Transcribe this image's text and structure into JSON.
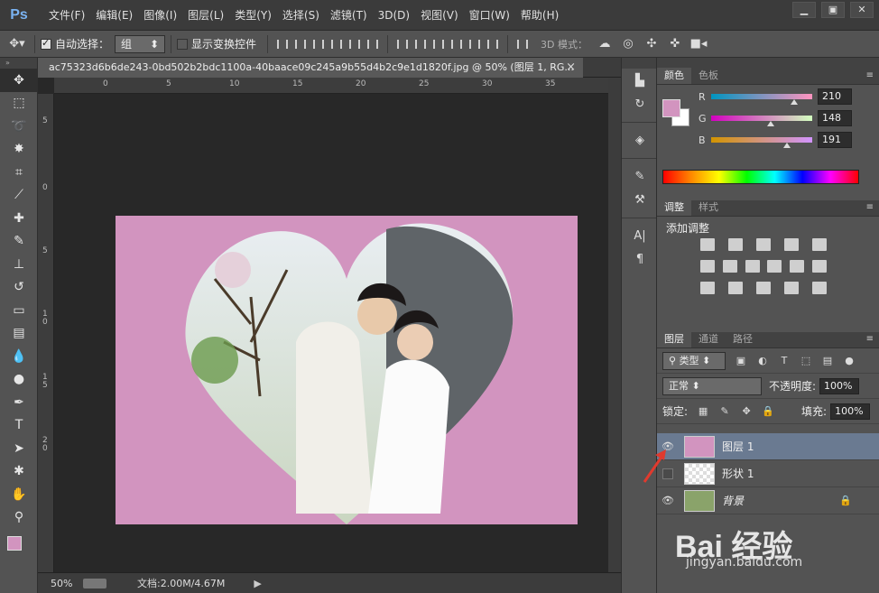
{
  "app": {
    "logo": "Ps"
  },
  "menu": [
    "文件(F)",
    "编辑(E)",
    "图像(I)",
    "图层(L)",
    "类型(Y)",
    "选择(S)",
    "滤镜(T)",
    "3D(D)",
    "视图(V)",
    "窗口(W)",
    "帮助(H)"
  ],
  "options": {
    "auto_select_label": "自动选择：",
    "auto_select_checked": true,
    "group_value": "组",
    "transform_label": "显示变换控件",
    "transform_checked": false,
    "mode3d_label": "3D 模式："
  },
  "document": {
    "tab_title": "ac75323d6b6de243-0bd502b2bdc1100a-40baace09c245a9b55d4b2c9e1d1820f.jpg @ 50% (图层 1, RG...",
    "zoom": "50%",
    "doc_size": "文档:2.00M/4.67M",
    "ruler_top": [
      "0",
      "5",
      "10",
      "15",
      "20",
      "25",
      "30",
      "35"
    ],
    "ruler_left": [
      "5",
      "0",
      "5",
      "1 0",
      "1 5",
      "2 0"
    ],
    "canvas_color": "#d294bf"
  },
  "color_panel": {
    "tabs": [
      "颜色",
      "色板"
    ],
    "fg_color": "#d294bf",
    "r_label": "R",
    "g_label": "G",
    "b_label": "B",
    "r": "210",
    "g": "148",
    "b": "191"
  },
  "adjust_panel": {
    "tabs": [
      "调整",
      "样式"
    ],
    "title": "添加调整"
  },
  "layers_panel": {
    "tabs": [
      "图层",
      "通道",
      "路径"
    ],
    "filter_label": "类型",
    "blend_mode": "正常",
    "opacity_label": "不透明度:",
    "opacity": "100%",
    "lock_label": "锁定:",
    "fill_label": "填充:",
    "fill": "100%",
    "layers": [
      {
        "name": "图层 1",
        "visible": true,
        "selected": true
      },
      {
        "name": "形状 1",
        "visible": false,
        "selected": false
      },
      {
        "name": "背景",
        "visible": true,
        "selected": false,
        "locked": true
      }
    ]
  },
  "watermark": {
    "brand": "Bai 经验",
    "url": "jingyan.baidu.com"
  }
}
